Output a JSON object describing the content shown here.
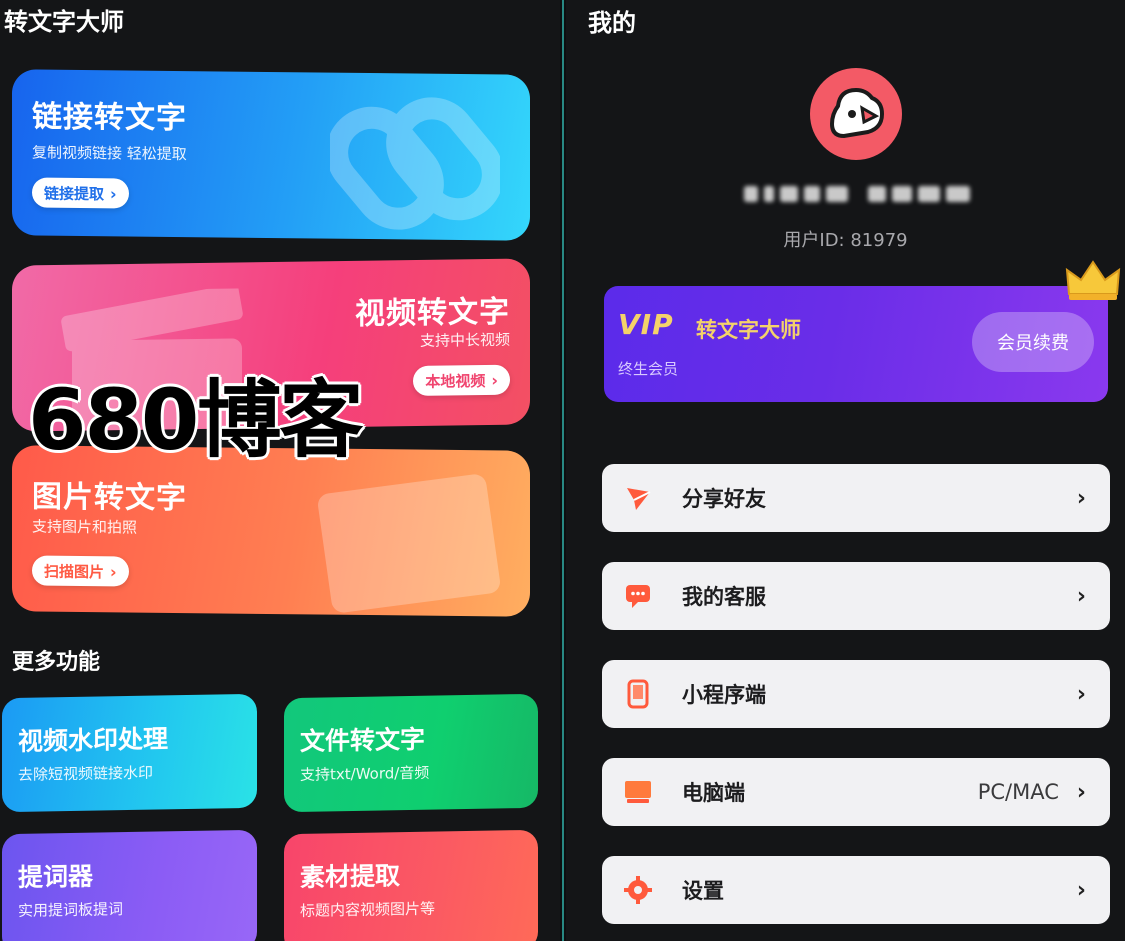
{
  "left": {
    "title": "转文字大师",
    "link_card": {
      "title": "链接转文字",
      "subtitle": "复制视频链接 轻松提取",
      "button": "链接提取"
    },
    "video_card": {
      "title": "视频转文字",
      "subtitle": "支持中长视频",
      "button": "本地视频"
    },
    "image_card": {
      "title": "图片转文字",
      "subtitle": "支持图片和拍照",
      "button": "扫描图片"
    },
    "section_title": "更多功能",
    "more": [
      {
        "title": "视频水印处理",
        "subtitle": "去除短视频链接水印"
      },
      {
        "title": "文件转文字",
        "subtitle": "支持txt/Word/音频"
      },
      {
        "title": "提词器",
        "subtitle": "实用提词板提词"
      },
      {
        "title": "素材提取",
        "subtitle": "标题内容视频图片等"
      }
    ],
    "watermark": "680博客"
  },
  "right": {
    "title": "我的",
    "user_id": "用户ID: 81979",
    "vip": {
      "logo": "VIP",
      "brand": "转文字大师",
      "level": "终生会员",
      "renew": "会员续费"
    },
    "menu": [
      {
        "label": "分享好友",
        "icon": "share-icon",
        "value": ""
      },
      {
        "label": "我的客服",
        "icon": "customer-service-icon",
        "value": ""
      },
      {
        "label": "小程序端",
        "icon": "mini-program-icon",
        "value": ""
      },
      {
        "label": "电脑端",
        "icon": "computer-icon",
        "value": "PC/MAC"
      },
      {
        "label": "设置",
        "icon": "settings-icon",
        "value": ""
      }
    ]
  },
  "colors": {
    "accent_orange": "#ff5a3c",
    "vip_gold": "#f4d26a",
    "vip_purple": "#6a2de8"
  }
}
